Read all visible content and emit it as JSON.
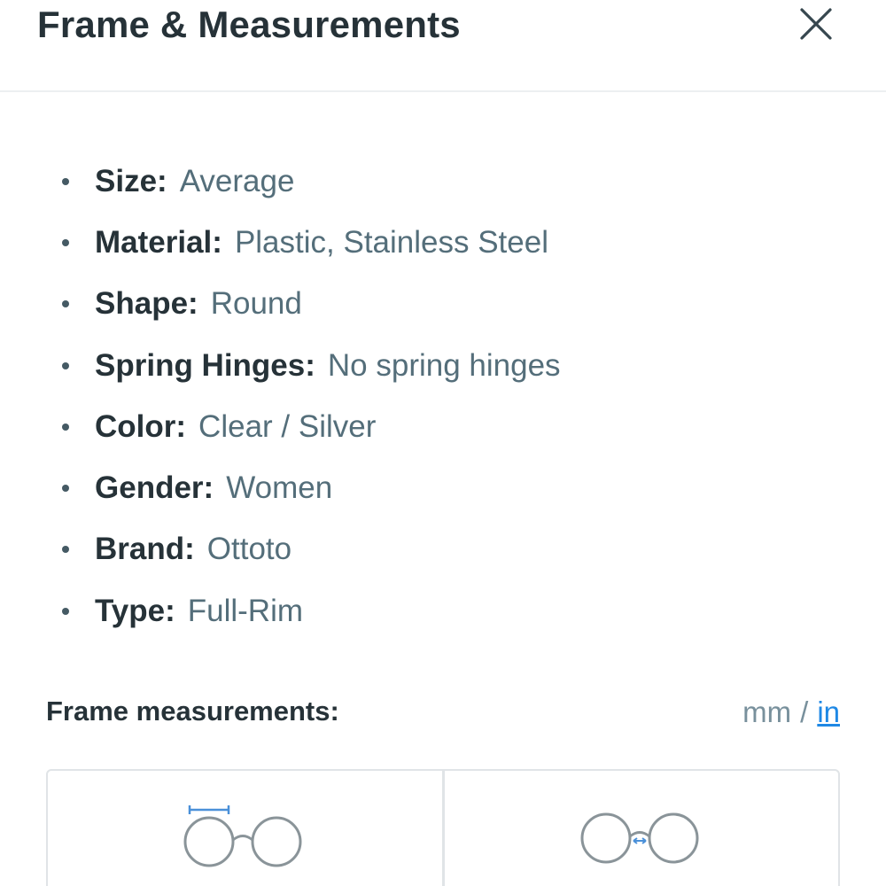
{
  "header": {
    "title": "Frame & Measurements",
    "close_icon": "close-icon"
  },
  "specs": [
    {
      "label": "Size:",
      "value": "Average"
    },
    {
      "label": "Material:",
      "value": "Plastic, Stainless Steel"
    },
    {
      "label": "Shape:",
      "value": "Round"
    },
    {
      "label": "Spring Hinges:",
      "value": "No spring hinges"
    },
    {
      "label": "Color:",
      "value": "Clear / Silver"
    },
    {
      "label": "Gender:",
      "value": "Women"
    },
    {
      "label": "Brand:",
      "value": "Ottoto"
    },
    {
      "label": "Type:",
      "value": "Full-Rim"
    }
  ],
  "measurements": {
    "title": "Frame measurements:",
    "unit_mm": "mm",
    "unit_separator": "/",
    "unit_in": "in",
    "selected_unit": "in",
    "cards": [
      {
        "icon": "lens-width-icon"
      },
      {
        "icon": "bridge-width-icon"
      }
    ]
  },
  "colors": {
    "accent": "#1e88e5",
    "text_dark": "#263238",
    "text_muted": "#546e7a",
    "icon_gray": "#8a9499"
  }
}
